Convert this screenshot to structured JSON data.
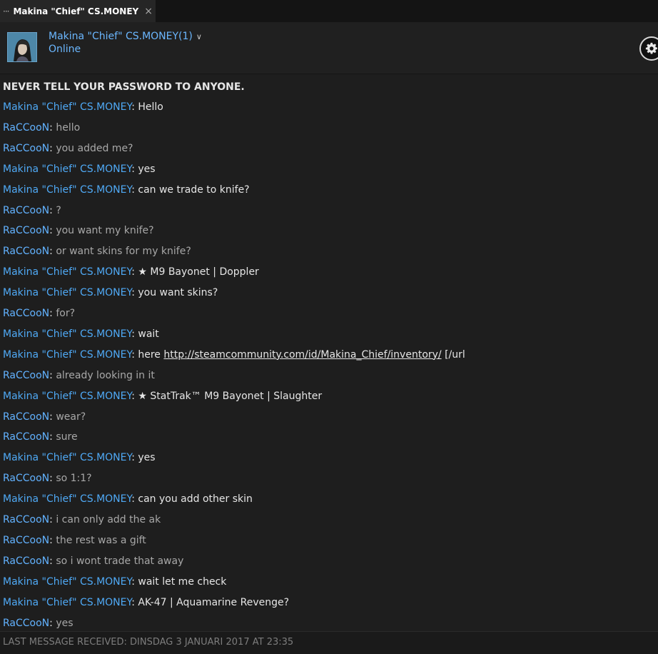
{
  "tab": {
    "dots": "···",
    "title": "Makina \"Chief\" CS.MONEY",
    "close": "×"
  },
  "header": {
    "name": "Makina \"Chief\" CS.MONEY(1)",
    "chevron": "∨",
    "status": "Online",
    "avatar_icon": "avatar-icon",
    "settings_icon": "gear-icon"
  },
  "chat": {
    "warning": "NEVER TELL YOUR PASSWORD TO ANYONE.",
    "messages": [
      {
        "sender": "Makina \"Chief\" CS.MONEY",
        "self": false,
        "text": "Hello"
      },
      {
        "sender": "RaCCooN",
        "self": true,
        "text": "hello"
      },
      {
        "sender": "RaCCooN",
        "self": true,
        "text": "you added me?"
      },
      {
        "sender": "Makina \"Chief\" CS.MONEY",
        "self": false,
        "text": "yes"
      },
      {
        "sender": "Makina \"Chief\" CS.MONEY",
        "self": false,
        "text": "can we trade to knife?"
      },
      {
        "sender": "RaCCooN",
        "self": true,
        "text": "?"
      },
      {
        "sender": "RaCCooN",
        "self": true,
        "text": "you want my knife?"
      },
      {
        "sender": "RaCCooN",
        "self": true,
        "text": "or want skins for my knife?"
      },
      {
        "sender": "Makina \"Chief\" CS.MONEY",
        "self": false,
        "text": "★ M9 Bayonet | Doppler"
      },
      {
        "sender": "Makina \"Chief\" CS.MONEY",
        "self": false,
        "text": "you want skins?"
      },
      {
        "sender": "RaCCooN",
        "self": true,
        "text": "for?"
      },
      {
        "sender": "Makina \"Chief\" CS.MONEY",
        "self": false,
        "text": "wait"
      },
      {
        "sender": "Makina \"Chief\" CS.MONEY",
        "self": false,
        "text": "here ",
        "link": "http://steamcommunity.com/id/Makina_Chief/inventory/",
        "suffix": " [/url"
      },
      {
        "sender": "RaCCooN",
        "self": true,
        "text": "already looking in it"
      },
      {
        "sender": "Makina \"Chief\" CS.MONEY",
        "self": false,
        "text": "★ StatTrak™ M9 Bayonet | Slaughter"
      },
      {
        "sender": "RaCCooN",
        "self": true,
        "text": "wear?"
      },
      {
        "sender": "RaCCooN",
        "self": true,
        "text": "sure"
      },
      {
        "sender": "Makina \"Chief\" CS.MONEY",
        "self": false,
        "text": "yes"
      },
      {
        "sender": "RaCCooN",
        "self": true,
        "text": "so 1:1?"
      },
      {
        "sender": "Makina \"Chief\" CS.MONEY",
        "self": false,
        "text": "can you add other skin"
      },
      {
        "sender": "RaCCooN",
        "self": true,
        "text": "i can only add the ak"
      },
      {
        "sender": "RaCCooN",
        "self": true,
        "text": "the rest was a gift"
      },
      {
        "sender": "RaCCooN",
        "self": true,
        "text": "so i wont trade that away"
      },
      {
        "sender": "Makina \"Chief\" CS.MONEY",
        "self": false,
        "text": "wait let me check"
      },
      {
        "sender": "Makina \"Chief\" CS.MONEY",
        "self": false,
        "text": "AK-47 | Aquamarine Revenge?"
      },
      {
        "sender": "RaCCooN",
        "self": true,
        "text": "yes"
      }
    ]
  },
  "footer": {
    "last_message": "LAST MESSAGE RECEIVED: DINSDAG 3 JANUARI 2017 AT 23:35"
  },
  "colors": {
    "background": "#1e1e1e",
    "sender_blue": "#62b2ff",
    "self_text": "#a8a8a8",
    "other_text": "#e6e6e6"
  }
}
